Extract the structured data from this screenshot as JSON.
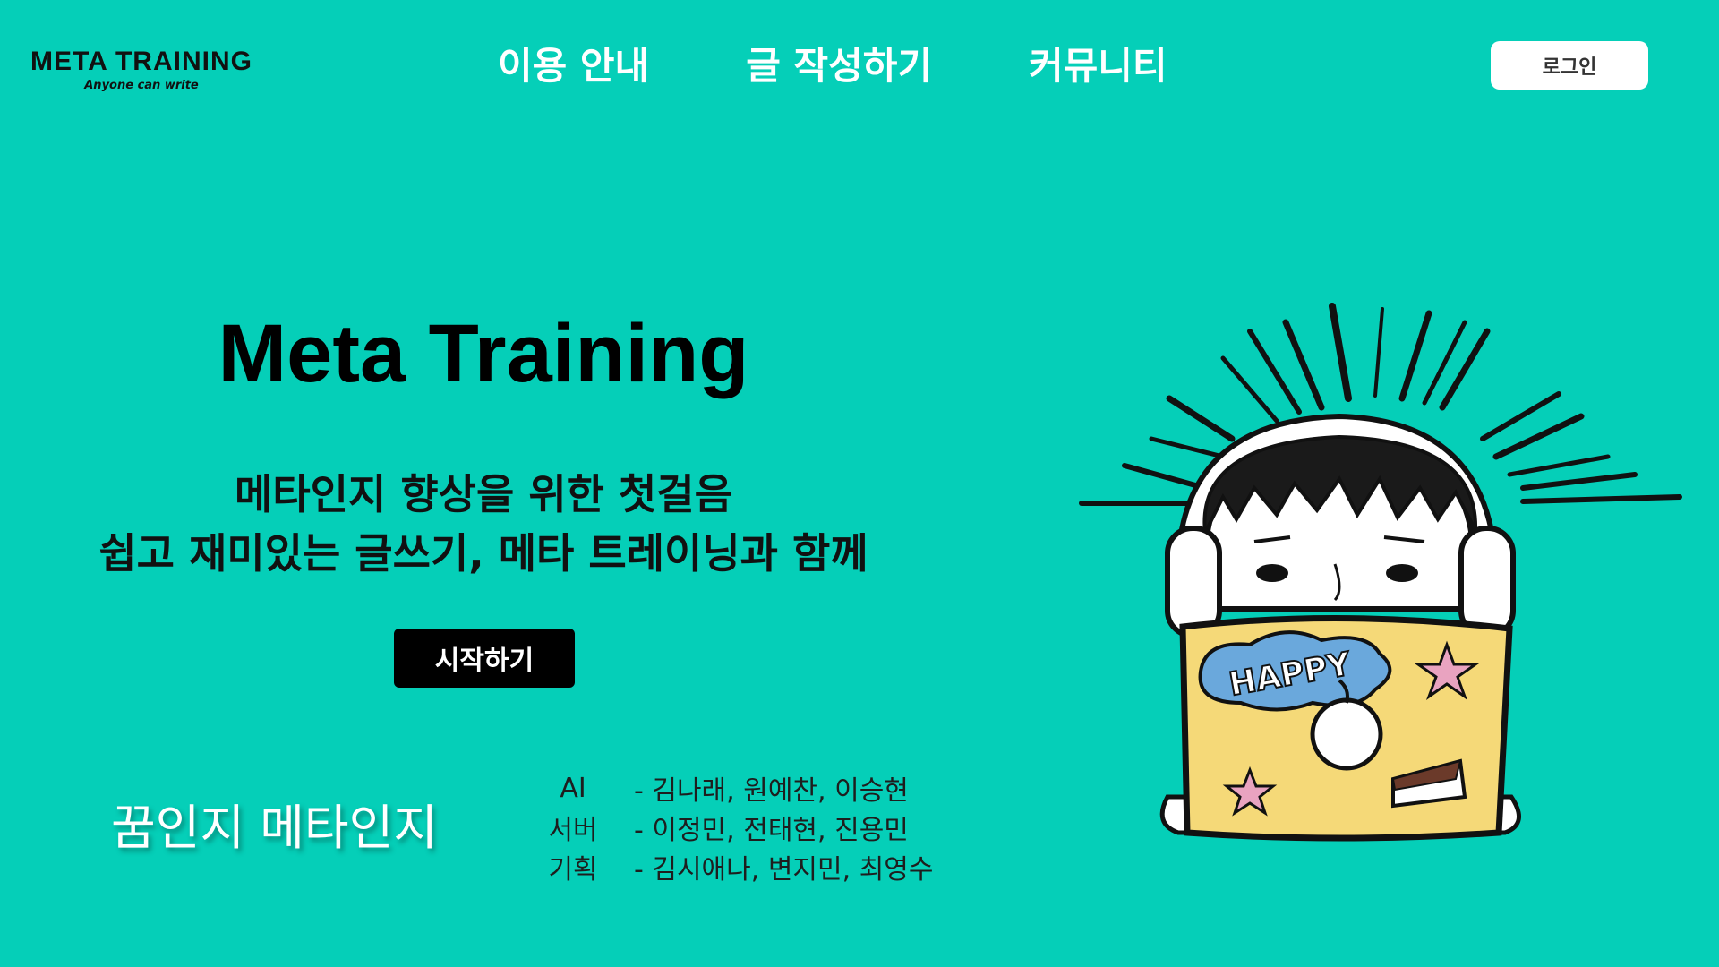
{
  "header": {
    "logo": {
      "title": "META TRAINING",
      "tagline": "Anyone can write"
    },
    "nav": [
      {
        "label": "이용 안내"
      },
      {
        "label": "글 작성하기"
      },
      {
        "label": "커뮤니티"
      }
    ],
    "login_label": "로그인"
  },
  "hero": {
    "title": "Meta Training",
    "subtitle_line1": "메타인지 향상을 위한 첫걸음",
    "subtitle_line2": "쉽고 재미있는 글쓰기, 메타 트레이닝과 함께",
    "start_label": "시작하기"
  },
  "slogan": "꿈인지 메타인지",
  "team": [
    {
      "role": "AI",
      "members": "- 김나래, 원예찬, 이승현"
    },
    {
      "role": "서버",
      "members": "- 이정민, 전태현, 진용민"
    },
    {
      "role": "기획",
      "members": "- 김시애나, 변지민, 최영수"
    }
  ],
  "illustration": {
    "laptop_sticker_text": "HAPPY"
  },
  "colors": {
    "background": "#05cfb8",
    "button_dark": "#000000",
    "button_light": "#ffffff",
    "laptop": "#f5d978",
    "sticker_blue": "#6aa8dc",
    "star_pink": "#e9a3c0"
  }
}
